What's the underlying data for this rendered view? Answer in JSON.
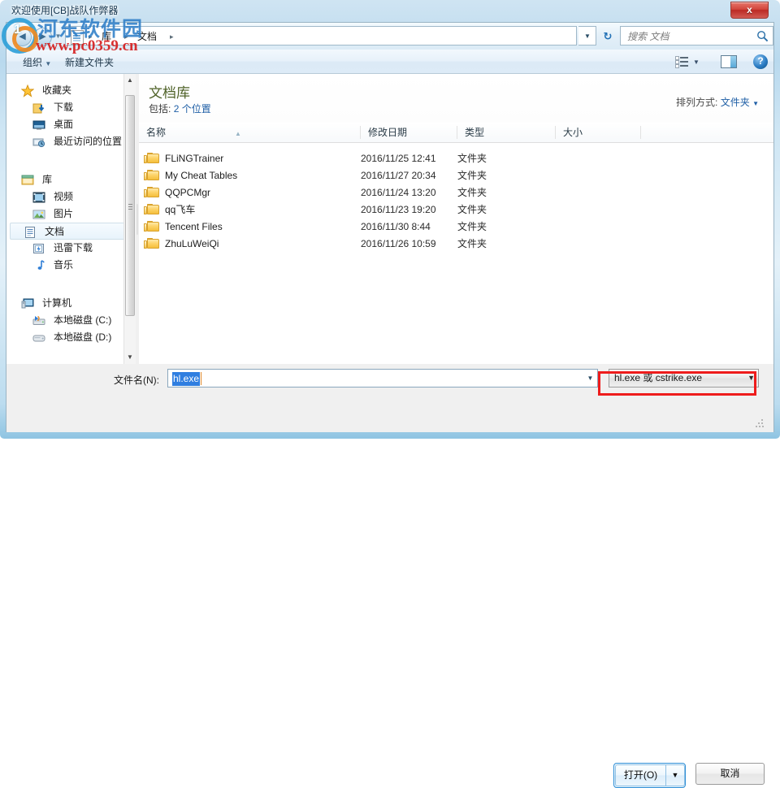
{
  "window": {
    "title": "欢迎使用[CB]战队作弊器",
    "close_label": "x"
  },
  "address_bar": {
    "back_icon": "back-arrow-icon",
    "forward_icon": "forward-arrow-icon",
    "history_icon": "chevron-down-icon",
    "breadcrumb_icon": "library-icon",
    "crumbs": [
      "库",
      "文档"
    ],
    "separator": "▸",
    "dropdown_icon": "chevron-down-icon",
    "refresh_icon": "refresh-icon",
    "refresh_glyph": "↻",
    "search_placeholder": "搜索 文档",
    "search_icon": "search-icon"
  },
  "command_bar": {
    "organize_label": "组织",
    "organize_caret": "▼",
    "new_folder_label": "新建文件夹",
    "view_icon": "view-options-icon",
    "view_caret": "▼",
    "preview_pane_icon": "preview-pane-icon",
    "help_icon": "help-icon",
    "help_glyph": "?"
  },
  "sidebar": {
    "groups": [
      {
        "header": "收藏夹",
        "header_icon": "star-icon",
        "items": [
          {
            "label": "下载",
            "icon": "downloads-icon"
          },
          {
            "label": "桌面",
            "icon": "desktop-icon"
          },
          {
            "label": "最近访问的位置",
            "icon": "recent-places-icon"
          }
        ]
      },
      {
        "header": "库",
        "header_icon": "libraries-icon",
        "items": [
          {
            "label": "视频",
            "icon": "videos-icon"
          },
          {
            "label": "图片",
            "icon": "pictures-icon"
          },
          {
            "label": "文档",
            "icon": "documents-icon",
            "selected": true
          },
          {
            "label": "迅雷下载",
            "icon": "thunder-download-icon"
          },
          {
            "label": "音乐",
            "icon": "music-icon"
          }
        ]
      },
      {
        "header": "计算机",
        "header_icon": "computer-icon",
        "items": [
          {
            "label": "本地磁盘 (C:)",
            "icon": "system-drive-icon"
          },
          {
            "label": "本地磁盘 (D:)",
            "icon": "drive-icon"
          }
        ]
      }
    ],
    "scroll_up_icon": "scroll-up-icon",
    "scroll_down_icon": "scroll-down-icon"
  },
  "library_header": {
    "title": "文档库",
    "subtitle_prefix": "包括:",
    "subtitle_link": "2 个位置",
    "arrange_label": "排列方式:",
    "arrange_value": "文件夹",
    "arrange_caret": "▼"
  },
  "file_list": {
    "columns": [
      "名称",
      "修改日期",
      "类型",
      "大小"
    ],
    "sort_indicator": "▲",
    "rows": [
      {
        "name": "FLiNGTrainer",
        "date": "2016/11/25 12:41",
        "type": "文件夹",
        "size": ""
      },
      {
        "name": "My Cheat Tables",
        "date": "2016/11/27 20:34",
        "type": "文件夹",
        "size": ""
      },
      {
        "name": "QQPCMgr",
        "date": "2016/11/24 13:20",
        "type": "文件夹",
        "size": ""
      },
      {
        "name": "qq飞车",
        "date": "2016/11/23 19:20",
        "type": "文件夹",
        "size": ""
      },
      {
        "name": "Tencent Files",
        "date": "2016/11/30 8:44",
        "type": "文件夹",
        "size": ""
      },
      {
        "name": "ZhuLuWeiQi",
        "date": "2016/11/26 10:59",
        "type": "文件夹",
        "size": ""
      }
    ]
  },
  "footer": {
    "filename_label": "文件名(N):",
    "filename_value": "hl.exe",
    "filename_dropdown_icon": "chevron-down-icon",
    "filter_value": "hl.exe 或 cstrike.exe",
    "filter_caret": "▼",
    "open_label": "打开(O)",
    "open_split_caret": "▼",
    "cancel_label": "取消"
  },
  "watermark": {
    "site_name": "河东软件园",
    "url": "www.pc0359.cn",
    "logo_char": "1"
  },
  "colors": {
    "accent_blue": "#2f7ee0",
    "library_title": "#4f6228",
    "link_blue": "#1f5fa6",
    "highlight_red": "#ee1c1c",
    "folder_yellow": "#f5bf3c"
  }
}
